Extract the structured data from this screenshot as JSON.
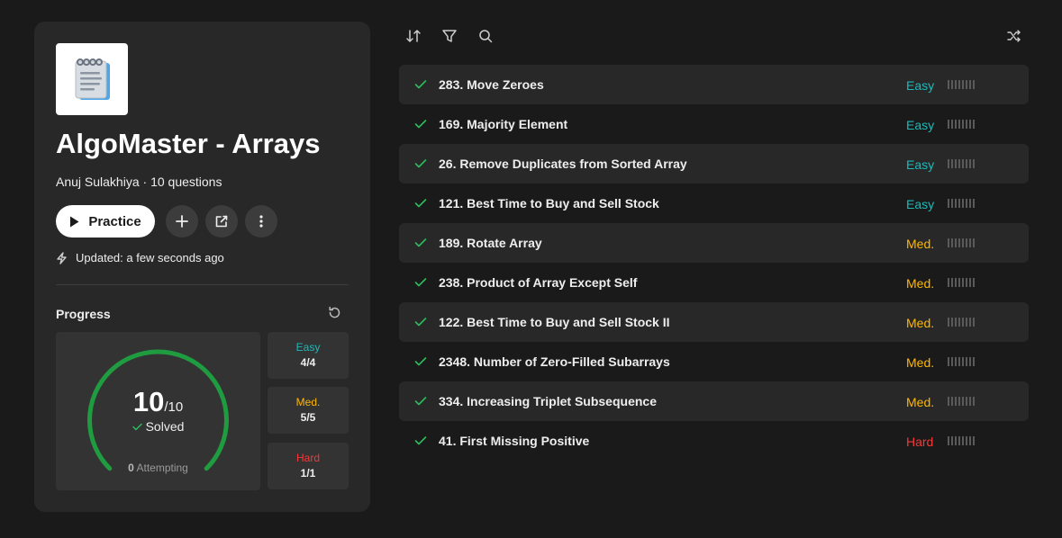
{
  "list": {
    "title": "AlgoMaster - Arrays",
    "author": "Anuj Sulakhiya",
    "separator": "·",
    "question_count": "10 questions",
    "practice_label": "Practice",
    "updated": "Updated: a few seconds ago"
  },
  "progress": {
    "label": "Progress",
    "solved": "10",
    "total": "/10",
    "solved_label": "Solved",
    "solved_fraction": 1.0,
    "attempting_count": "0",
    "attempting_label": "Attempting",
    "breakdown": [
      {
        "name": "Easy",
        "count": "4/4",
        "color": "#1cbaba"
      },
      {
        "name": "Med.",
        "count": "5/5",
        "color": "#ffb700"
      },
      {
        "name": "Hard",
        "count": "1/1",
        "color": "#f63737"
      }
    ]
  },
  "colors": {
    "accent_green": "#2cbb5d",
    "ring_green": "#1f9c3f",
    "easy": "#1cbaba",
    "medium": "#ffb700",
    "hard": "#f63737"
  },
  "toolbar": {
    "icons": [
      "sort-icon",
      "filter-icon",
      "search-icon",
      "shuffle-icon"
    ]
  },
  "problems": [
    {
      "title": "283. Move Zeroes",
      "difficulty": "Easy"
    },
    {
      "title": "169. Majority Element",
      "difficulty": "Easy"
    },
    {
      "title": "26. Remove Duplicates from Sorted Array",
      "difficulty": "Easy"
    },
    {
      "title": "121. Best Time to Buy and Sell Stock",
      "difficulty": "Easy"
    },
    {
      "title": "189. Rotate Array",
      "difficulty": "Med."
    },
    {
      "title": "238. Product of Array Except Self",
      "difficulty": "Med."
    },
    {
      "title": "122. Best Time to Buy and Sell Stock II",
      "difficulty": "Med."
    },
    {
      "title": "2348. Number of Zero-Filled Subarrays",
      "difficulty": "Med."
    },
    {
      "title": "334. Increasing Triplet Subsequence",
      "difficulty": "Med."
    },
    {
      "title": "41. First Missing Positive",
      "difficulty": "Hard"
    }
  ]
}
